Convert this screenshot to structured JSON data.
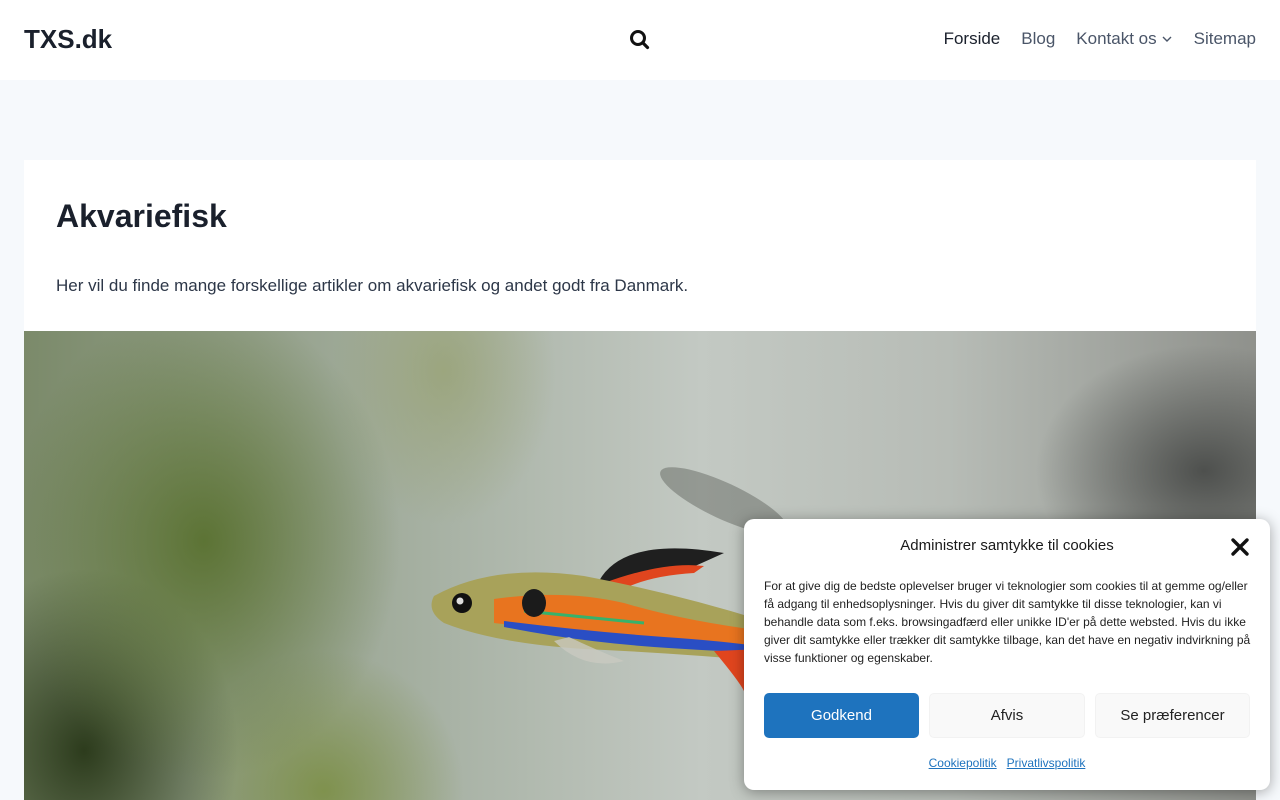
{
  "header": {
    "logo": "TXS.dk",
    "nav": [
      {
        "label": "Forside"
      },
      {
        "label": "Blog"
      },
      {
        "label": "Kontakt os"
      },
      {
        "label": "Sitemap"
      }
    ]
  },
  "main": {
    "title": "Akvariefisk",
    "intro": "Her vil du finde mange forskellige artikler om akvariefisk og andet godt fra Danmark."
  },
  "cookie": {
    "title": "Administrer samtykke til cookies",
    "body": "For at give dig de bedste oplevelser bruger vi teknologier som cookies til at gemme og/eller få adgang til enhedsoplysninger. Hvis du giver dit samtykke til disse teknologier, kan vi behandle data som f.eks. browsingadfærd eller unikke ID'er på dette websted. Hvis du ikke giver dit samtykke eller trækker dit samtykke tilbage, kan det have en negativ indvirkning på visse funktioner og egenskaber.",
    "accept_label": "Godkend",
    "deny_label": "Afvis",
    "prefs_label": "Se præferencer",
    "links": [
      {
        "label": "Cookiepolitik"
      },
      {
        "label": "Privatlivspolitik"
      }
    ]
  },
  "colors": {
    "accent": "#1e73be",
    "page_bg": "#f6f9fc",
    "text": "#1a202c"
  }
}
